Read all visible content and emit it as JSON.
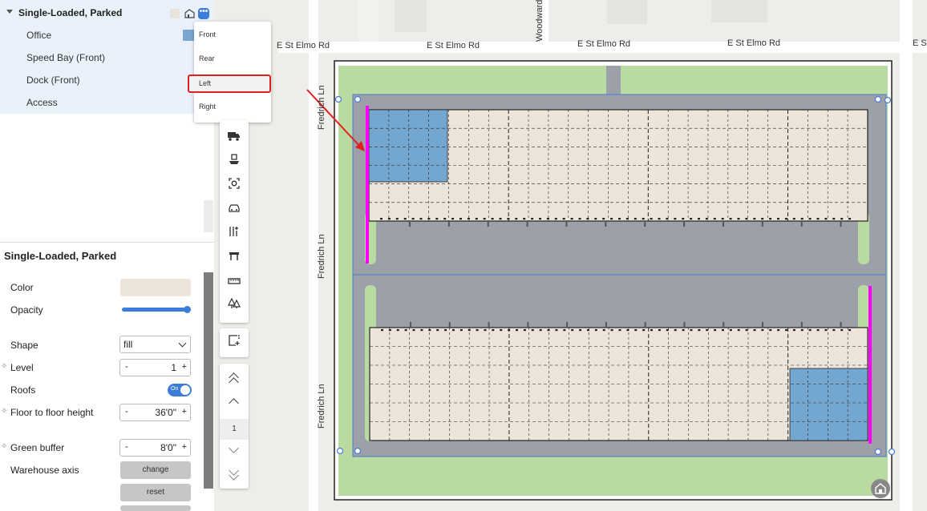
{
  "tree": {
    "parent_label": "Single-Loaded, Parked",
    "more_icon_text": "•••",
    "children": [
      {
        "label": "Office"
      },
      {
        "label": "Speed Bay (Front)"
      },
      {
        "label": "Dock (Front)"
      },
      {
        "label": "Access"
      }
    ]
  },
  "menu": {
    "items": [
      {
        "label": "Front"
      },
      {
        "label": "Rear"
      },
      {
        "label": "Left",
        "highlighted": true
      },
      {
        "label": "Right"
      }
    ]
  },
  "properties": {
    "title": "Single-Loaded, Parked",
    "color_label": "Color",
    "color_value": "#eee5da",
    "opacity_label": "Opacity",
    "opacity_value": 1.0,
    "shape_label": "Shape",
    "shape_value": "fill",
    "level_label": "Level",
    "level_value": "1",
    "roofs_label": "Roofs",
    "roofs_toggle": "On",
    "floor_height_label": "Floor to floor height",
    "floor_height_value": "36'0\"",
    "green_buffer_label": "Green buffer",
    "green_buffer_value": "8'0\"",
    "warehouse_axis_label": "Warehouse axis",
    "change_label": "change",
    "reset_label": "reset",
    "minus": "-",
    "plus": "+"
  },
  "map": {
    "road_top": "E St Elmo Rd",
    "road_left": "Fredrich Ln",
    "road_woodward": "Woodward",
    "road_top_trunc": "E S"
  },
  "toolbar": {
    "level_number": "1"
  },
  "colors": {
    "accent": "#3b7dd8",
    "building": "#eee5da",
    "office": "#74a7cf",
    "green": "#b9dba1",
    "pavement": "#9ca0a8",
    "highlight_edge": "#ff00ff",
    "annotation_red": "#e02020"
  }
}
